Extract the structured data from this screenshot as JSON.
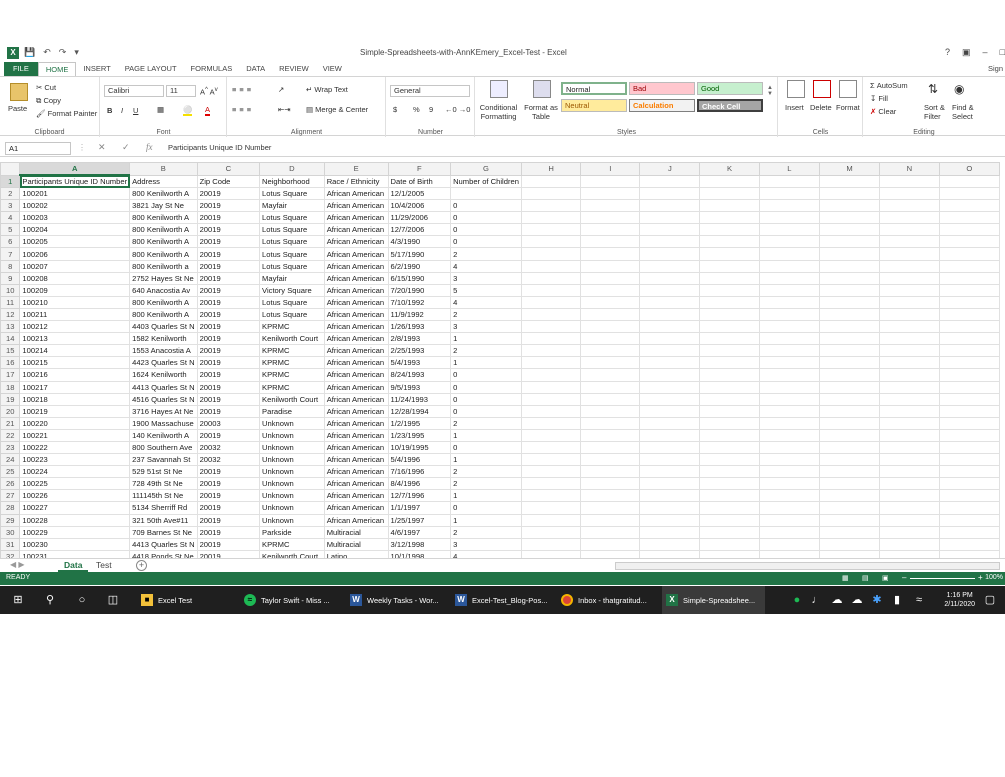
{
  "window": {
    "title": "Simple-Spreadsheets-with-AnnKEmery_Excel-Test - Excel",
    "help": "?",
    "signin": "Sign"
  },
  "tabs": [
    "FILE",
    "HOME",
    "INSERT",
    "PAGE LAYOUT",
    "FORMULAS",
    "DATA",
    "REVIEW",
    "VIEW"
  ],
  "ribbon": {
    "clipboard": {
      "paste": "Paste",
      "cut": "Cut",
      "copy": "Copy",
      "format_painter": "Format Painter",
      "label": "Clipboard"
    },
    "font": {
      "name": "Calibri",
      "size": "11",
      "label": "Font",
      "bold": "B",
      "italic": "I",
      "underline": "U"
    },
    "alignment": {
      "wrap": "Wrap Text",
      "merge": "Merge & Center",
      "label": "Alignment"
    },
    "number": {
      "format": "General",
      "label": "Number",
      "currency": "$",
      "percent": "%",
      "comma": "9"
    },
    "styles": {
      "conditional": "Conditional Formatting",
      "format_table": "Format as Table",
      "normal": "Normal",
      "bad": "Bad",
      "good": "Good",
      "neutral": "Neutral",
      "calculation": "Calculation",
      "check_cell": "Check Cell",
      "label": "Styles"
    },
    "cells": {
      "insert": "Insert",
      "delete": "Delete",
      "format": "Format",
      "label": "Cells"
    },
    "editing": {
      "autosum": "AutoSum",
      "fill": "Fill",
      "clear": "Clear",
      "sort": "Sort & Filter",
      "find": "Find & Select",
      "label": "Editing"
    }
  },
  "formula_bar": {
    "name_box": "A1",
    "fx": "fx",
    "formula": "Participants Unique ID Number"
  },
  "columns": [
    "A",
    "B",
    "C",
    "D",
    "E",
    "F",
    "G",
    "H",
    "I",
    "J",
    "K",
    "L",
    "M",
    "N",
    "O"
  ],
  "rows": [
    [
      "Participants Unique ID Number",
      "Address",
      "Zip Code",
      "Neighborhood",
      "Race / Ethnicity",
      "Date of Birth",
      "Number of Children"
    ],
    [
      "100201",
      "800 Kenilworth A",
      "20019",
      "Lotus Square",
      "African American",
      "12/1/2005",
      ""
    ],
    [
      "100202",
      "3821 Jay St Ne",
      "20019",
      "Mayfair",
      "African American",
      "10/4/2006",
      "0"
    ],
    [
      "100203",
      "800 Kenilworth A",
      "20019",
      "Lotus Square",
      "African American",
      "11/29/2006",
      "0"
    ],
    [
      "100204",
      "800 Kenilworth A",
      "20019",
      "Lotus Square",
      "African American",
      "12/7/2006",
      "0"
    ],
    [
      "100205",
      "800 Kenilworth A",
      "20019",
      "Lotus Square",
      "African American",
      "4/3/1990",
      "0"
    ],
    [
      "100206",
      "800 Kenilworth A",
      "20019",
      "Lotus Square",
      "African American",
      "5/17/1990",
      "2"
    ],
    [
      "100207",
      "800 Kenilworth a",
      "20019",
      "Lotus Square",
      "African American",
      "6/2/1990",
      "4"
    ],
    [
      "100208",
      "2752 Hayes St Ne",
      "20019",
      "Mayfair",
      "African American",
      "6/15/1990",
      "3"
    ],
    [
      "100209",
      "640 Anacostia Av",
      "20019",
      "Victory Square",
      "African American",
      "7/20/1990",
      "5"
    ],
    [
      "100210",
      "800 Kenilworth A",
      "20019",
      "Lotus Square",
      "African American",
      "7/10/1992",
      "4"
    ],
    [
      "100211",
      "800 Kenilworth A",
      "20019",
      "Lotus Square",
      "African American",
      "11/9/1992",
      "2"
    ],
    [
      "100212",
      "4403 Quarles St N",
      "20019",
      "KPRMC",
      "African American",
      "1/26/1993",
      "3"
    ],
    [
      "100213",
      "1582 Kenilworth",
      "20019",
      "Kenilworth Court",
      "African American",
      "2/8/1993",
      "1"
    ],
    [
      "100214",
      "1553 Anacostia A",
      "20019",
      "KPRMC",
      "African American",
      "2/25/1993",
      "2"
    ],
    [
      "100215",
      "4423 Quarles St N",
      "20019",
      "KPRMC",
      "African American",
      "5/4/1993",
      "1"
    ],
    [
      "100216",
      "1624 Kenilworth",
      "20019",
      "KPRMC",
      "African American",
      "8/24/1993",
      "0"
    ],
    [
      "100217",
      "4413 Quarles St N",
      "20019",
      "KPRMC",
      "African American",
      "9/5/1993",
      "0"
    ],
    [
      "100218",
      "4516 Quarles St N",
      "20019",
      "Kenilworth Court",
      "African American",
      "11/24/1993",
      "0"
    ],
    [
      "100219",
      "3716 Hayes At Ne",
      "20019",
      "Paradise",
      "African American",
      "12/28/1994",
      "0"
    ],
    [
      "100220",
      "1900 Massachuse",
      "20003",
      "Unknown",
      "African American",
      "1/2/1995",
      "2"
    ],
    [
      "100221",
      "140 Kenilworth A",
      "20019",
      "Unknown",
      "African American",
      "1/23/1995",
      "1"
    ],
    [
      "100222",
      "800 Southern Ave",
      "20032",
      "Unknown",
      "African American",
      "10/19/1995",
      "0"
    ],
    [
      "100223",
      "237 Savannah St",
      "20032",
      "Unknown",
      "African American",
      "5/4/1996",
      "1"
    ],
    [
      "100224",
      "529 51st St Ne",
      "20019",
      "Unknown",
      "African American",
      "7/16/1996",
      "2"
    ],
    [
      "100225",
      "728 49th St Ne",
      "20019",
      "Unknown",
      "African American",
      "8/4/1996",
      "2"
    ],
    [
      "100226",
      "111145th St Ne",
      "20019",
      "Unknown",
      "African American",
      "12/7/1996",
      "1"
    ],
    [
      "100227",
      "5134 Sherriff Rd",
      "20019",
      "Unknown",
      "African American",
      "1/1/1997",
      "0"
    ],
    [
      "100228",
      "321 50th Ave#11",
      "20019",
      "Unknown",
      "African American",
      "1/25/1997",
      "1"
    ],
    [
      "100229",
      "709 Barnes St Ne",
      "20019",
      "Parkside",
      "Multiracial",
      "4/6/1997",
      "2"
    ],
    [
      "100230",
      "4413 Quarles St N",
      "20019",
      "KPRMC",
      "Multiracial",
      "3/12/1998",
      "3"
    ],
    [
      "100231",
      "4418 Ponds St Ne",
      "20019",
      "Kenilworth Court",
      "Latino",
      "10/1/1998",
      "4"
    ]
  ],
  "sheets": {
    "active": "Data",
    "other": "Test",
    "add": "+"
  },
  "status": {
    "ready": "READY",
    "zoom": "100%"
  },
  "taskbar": {
    "apps": [
      "Excel Test",
      "Taylor Swift - Miss ...",
      "Weekly Tasks - Wor...",
      "Excel-Test_Blog-Pos...",
      "Inbox - thatgratitud...",
      "Simple-Spreadshee..."
    ],
    "time": "1:16 PM",
    "date": "2/11/2020"
  },
  "colors": {
    "excel_green": "#217346",
    "taskbar": "#1f1f1f"
  }
}
